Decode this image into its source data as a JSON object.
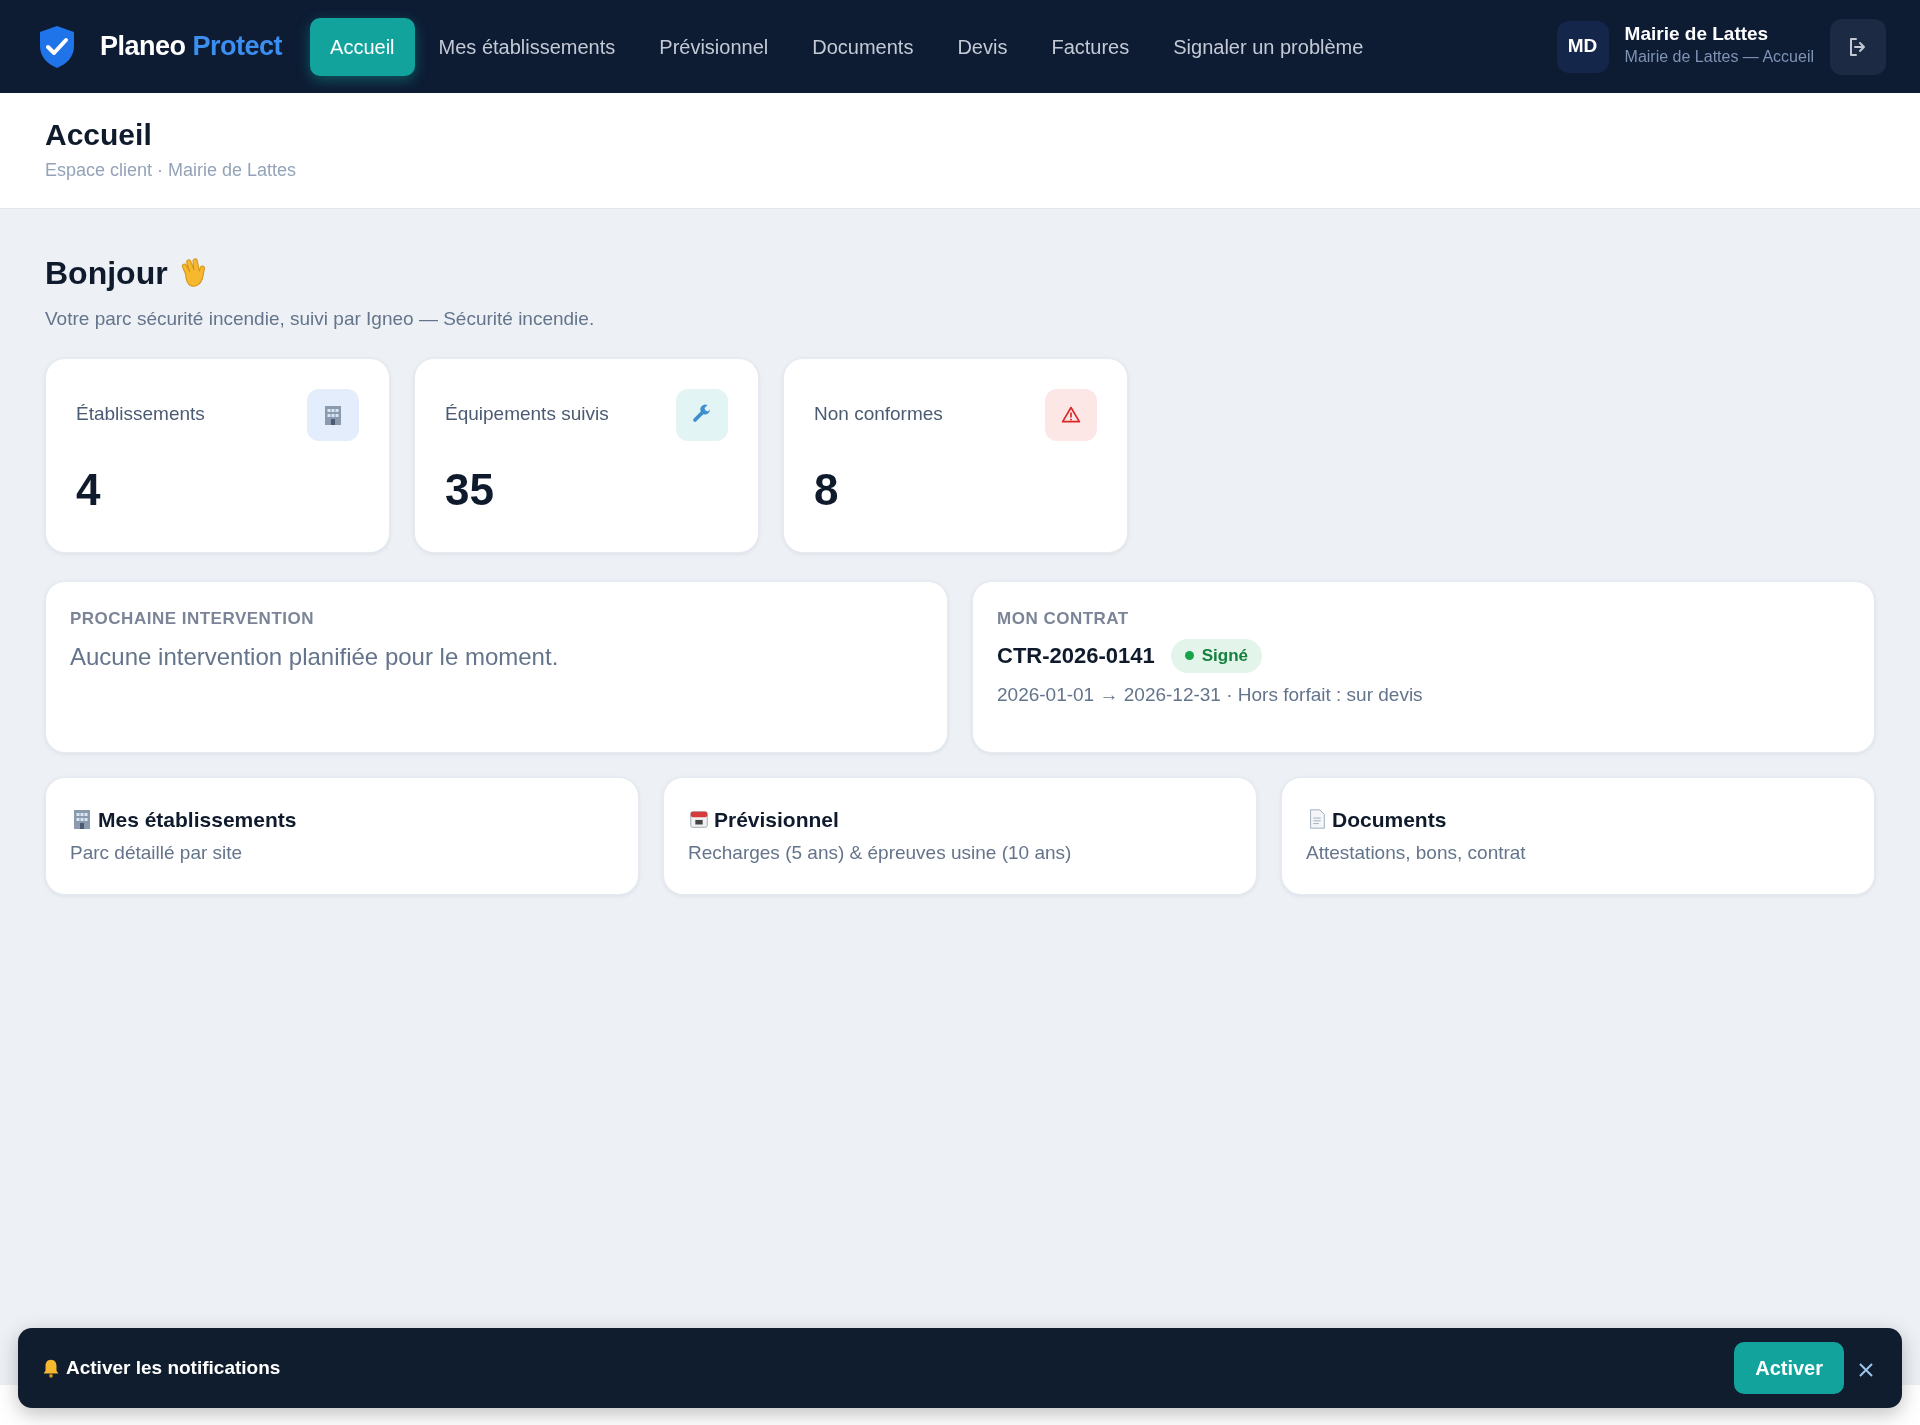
{
  "brand": {
    "name": "Planeo",
    "accent": "Protect"
  },
  "nav": [
    {
      "label": "Accueil",
      "selected": true
    },
    {
      "label": "Mes établissements",
      "selected": false
    },
    {
      "label": "Prévisionnel",
      "selected": false
    },
    {
      "label": "Documents",
      "selected": false
    },
    {
      "label": "Devis",
      "selected": false
    },
    {
      "label": "Factures",
      "selected": false
    },
    {
      "label": "Signaler un problème",
      "selected": false
    }
  ],
  "user": {
    "initials": "MD",
    "name": "Mairie de Lattes",
    "subtitle": "Mairie de Lattes — Accueil"
  },
  "page": {
    "title": "Accueil",
    "subtitle": "Espace client · Mairie de Lattes"
  },
  "greeting": {
    "title": "Bonjour",
    "text": "Votre parc sécurité incendie, suivi par Igneo — Sécurité incendie."
  },
  "stats": [
    {
      "label": "Établissements",
      "value": "4",
      "kind": "building"
    },
    {
      "label": "Équipements suivis",
      "value": "35",
      "kind": "wrench"
    },
    {
      "label": "Non conformes",
      "value": "8",
      "kind": "warning"
    }
  ],
  "next_intervention": {
    "heading": "PROCHAINE INTERVENTION",
    "text": "Aucune intervention planifiée pour le moment."
  },
  "contract": {
    "heading": "MON CONTRAT",
    "number": "CTR-2026-0141",
    "status": "Signé",
    "color": "#16a34a",
    "details": "2026-01-01 → 2026-12-31 · Hors forfait : sur devis"
  },
  "shortcuts": [
    {
      "title": "Mes établissements",
      "text": "Parc détaillé par site",
      "kind": "building"
    },
    {
      "title": "Prévisionnel",
      "text": "Recharges (5 ans) & épreuves usine (10 ans)",
      "kind": "calendar"
    },
    {
      "title": "Documents",
      "text": "Attestations, bons, contrat",
      "kind": "document"
    }
  ],
  "notification": {
    "text": "Activer les notifications",
    "button": "Activer"
  }
}
